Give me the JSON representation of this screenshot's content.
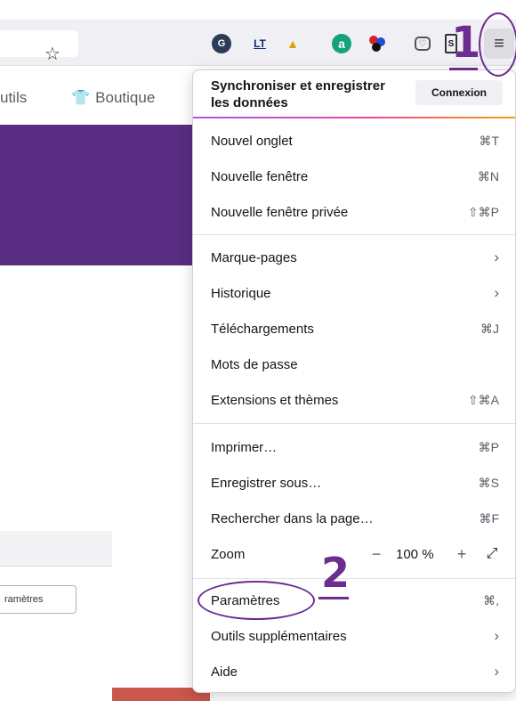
{
  "browser": {
    "toolbar": {
      "bookmark_star_icon": "star-icon",
      "extensions": [
        {
          "name": "g-extension-icon",
          "glyph": "G"
        },
        {
          "name": "languagetool-icon",
          "glyph": "LT"
        },
        {
          "name": "flask-icon",
          "glyph": "▲"
        },
        {
          "name": "a-extension-icon",
          "glyph": "a"
        },
        {
          "name": "colored-dots-icon",
          "glyph": ""
        },
        {
          "name": "pocket-icon",
          "glyph": "♡"
        },
        {
          "name": "box-extension-icon",
          "glyph": "S"
        }
      ],
      "menu_icon": "≡"
    }
  },
  "page": {
    "nav": {
      "outils_label": "utils",
      "boutique_label": "Boutique"
    },
    "parametres_button": "ramètres",
    "banner_color": "#592d82"
  },
  "menu": {
    "sync": {
      "title": "Synchroniser et enregistrer les données",
      "button": "Connexion"
    },
    "group1": [
      {
        "label": "Nouvel onglet",
        "shortcut": "⌘T"
      },
      {
        "label": "Nouvelle fenêtre",
        "shortcut": "⌘N"
      },
      {
        "label": "Nouvelle fenêtre privée",
        "shortcut": "⇧⌘P"
      }
    ],
    "group2": [
      {
        "label": "Marque-pages",
        "arrow": "›"
      },
      {
        "label": "Historique",
        "arrow": "›"
      },
      {
        "label": "Téléchargements",
        "shortcut": "⌘J"
      },
      {
        "label": "Mots de passe",
        "shortcut": ""
      },
      {
        "label": "Extensions et thèmes",
        "shortcut": "⇧⌘A"
      }
    ],
    "group3": [
      {
        "label": "Imprimer…",
        "shortcut": "⌘P"
      },
      {
        "label": "Enregistrer sous…",
        "shortcut": "⌘S"
      },
      {
        "label": "Rechercher dans la page…",
        "shortcut": "⌘F"
      }
    ],
    "zoom": {
      "label": "Zoom",
      "minus": "−",
      "value": "100 %",
      "plus": "+",
      "fullscreen": "⤢"
    },
    "group4": [
      {
        "label": "Paramètres",
        "shortcut": "⌘,"
      },
      {
        "label": "Outils supplémentaires",
        "arrow": "›"
      },
      {
        "label": "Aide",
        "arrow": "›"
      }
    ]
  },
  "annotations": {
    "step1": "1",
    "step2": "2",
    "color": "#6b2d8f"
  }
}
